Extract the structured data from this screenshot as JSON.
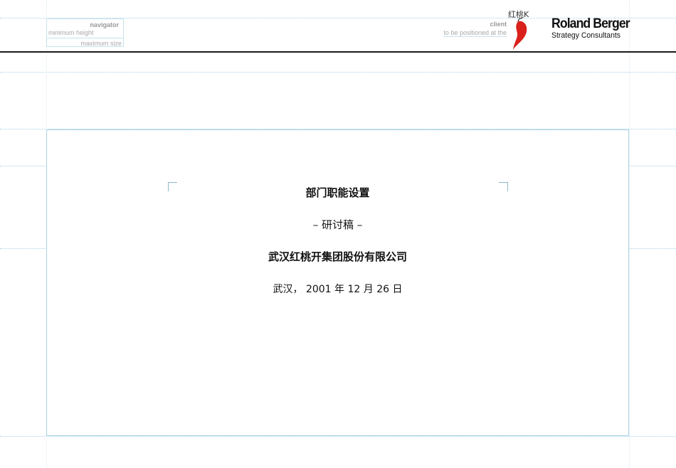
{
  "header": {
    "navigator": {
      "title": "navigator",
      "min_label": "minimum height",
      "max_label": "maximum size"
    },
    "client": {
      "title": "client",
      "note": "to be positioned at the"
    },
    "logo_text": "红桃K",
    "brand": {
      "name": "Roland Berger",
      "tagline": "Strategy Consultants"
    }
  },
  "slide": {
    "title": "部门职能设置",
    "subtitle": "– 研讨稿 –",
    "company": "武汉红桃开集团股份有限公司",
    "date": "武汉， 2001 年 12 月 26 日"
  },
  "colors": {
    "guide": "#a9d3e6",
    "rule": "#1a1a1a",
    "logo_red": "#d9201a"
  }
}
